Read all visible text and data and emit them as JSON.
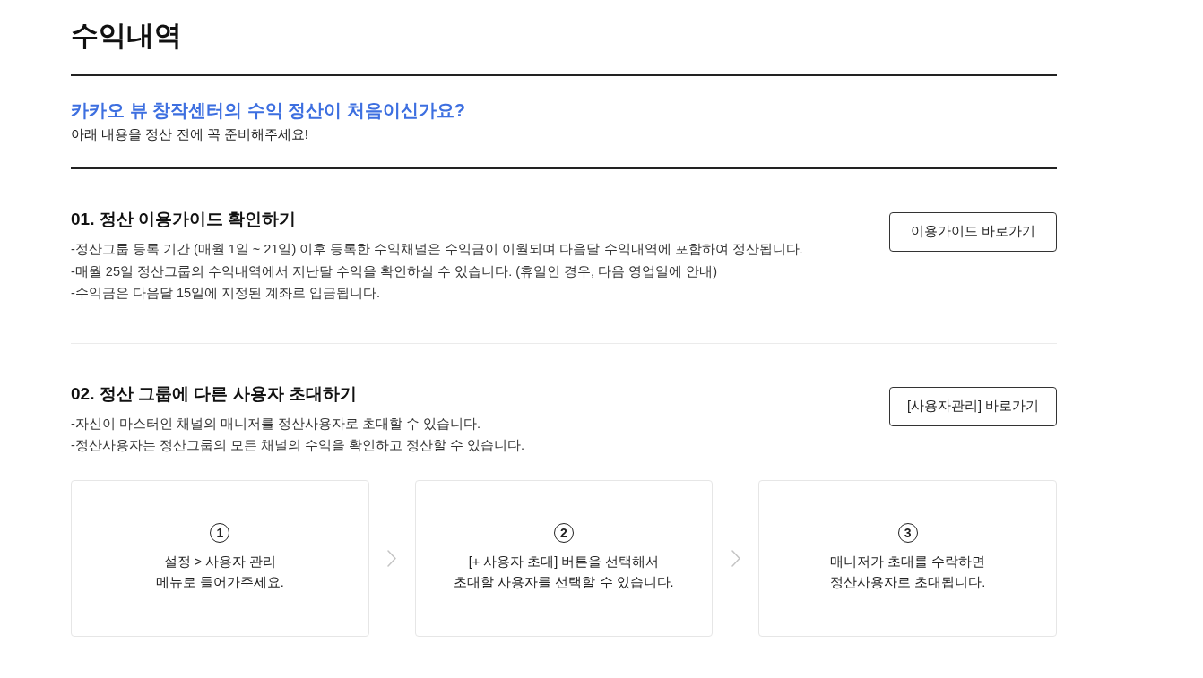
{
  "page": {
    "title": "수익내역"
  },
  "notice": {
    "heading": "카카오 뷰 창작센터의 수익 정산이 처음이신가요?",
    "text": "아래 내용을 정산 전에 꼭 준비해주세요!"
  },
  "sections": [
    {
      "heading": "01. 정산 이용가이드 확인하기",
      "lines": [
        "-정산그룹 등록 기간 (매월 1일 ~ 21일) 이후 등록한 수익채널은 수익금이 이월되며 다음달 수익내역에 포함하여 정산됩니다.",
        "-매월 25일 정산그룹의 수익내역에서 지난달 수익을 확인하실 수 있습니다. (휴일인 경우, 다음 영업일에 안내)",
        "-수익금은 다음달 15일에 지정된 계좌로 입금됩니다."
      ],
      "button": "이용가이드 바로가기"
    },
    {
      "heading": "02. 정산 그룹에 다른 사용자 초대하기",
      "lines": [
        "-자신이 마스터인 채널의 매니저를 정산사용자로 초대할 수 있습니다.",
        "-정산사용자는 정산그룹의 모든 채널의 수익을 확인하고 정산할 수 있습니다."
      ],
      "button": "[사용자관리] 바로가기",
      "steps": [
        {
          "number": "1",
          "lines": [
            "설정 > 사용자 관리",
            "메뉴로 들어가주세요."
          ]
        },
        {
          "number": "2",
          "lines": [
            "[+ 사용자 초대] 버튼을 선택해서",
            "초대할 사용자를 선택할 수 있습니다."
          ]
        },
        {
          "number": "3",
          "lines": [
            "매니저가 초대를 수락하면",
            "정산사용자로 초대됩니다."
          ]
        }
      ]
    }
  ]
}
